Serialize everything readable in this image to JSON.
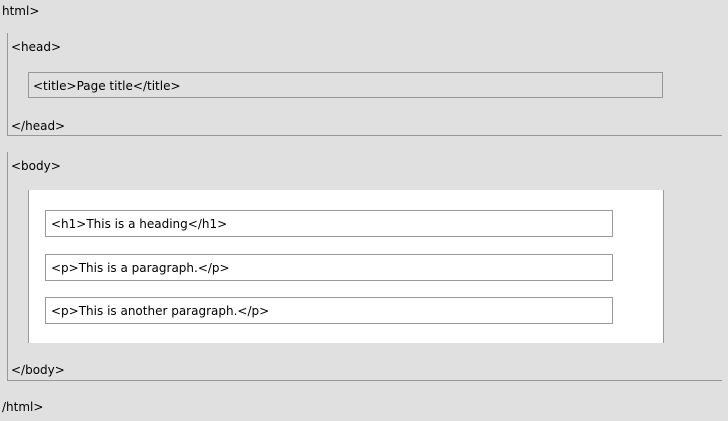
{
  "html": {
    "open_tag": "html>",
    "close_tag": "/html>"
  },
  "head": {
    "open_tag": "<head>",
    "close_tag": "</head>",
    "children": {
      "title": "<title>Page title</title>"
    }
  },
  "body": {
    "open_tag": "<body>",
    "close_tag": "</body>",
    "children": [
      "<h1>This is a heading</h1>",
      "<p>This is a paragraph.</p>",
      "<p>This is another paragraph.</p>"
    ]
  }
}
